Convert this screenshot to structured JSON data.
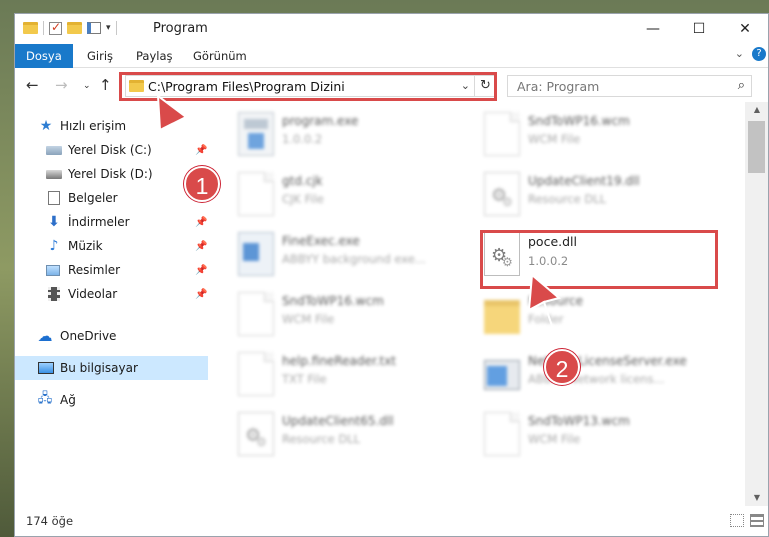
{
  "window": {
    "title": "Program"
  },
  "title_controls": {
    "minimize": "—",
    "maximize": "☐",
    "close": "✕"
  },
  "ribbon": {
    "tabs": [
      "Dosya",
      "Giriş",
      "Paylaş",
      "Görünüm"
    ]
  },
  "nav": {
    "address": "C:\\Program Files\\Program Dizini",
    "search_placeholder": "Ara: Program"
  },
  "sidebar": {
    "items": [
      {
        "label": "Hızlı erişim",
        "icon": "star-icon",
        "pinned": false
      },
      {
        "label": "Yerel Disk (C:)",
        "icon": "drive-icon",
        "pinned": true
      },
      {
        "label": "Yerel Disk (D:)",
        "icon": "drive-icon",
        "pinned": false
      },
      {
        "label": "Belgeler",
        "icon": "document-icon",
        "pinned": false
      },
      {
        "label": "İndirmeler",
        "icon": "download-icon",
        "pinned": true
      },
      {
        "label": "Müzik",
        "icon": "music-icon",
        "pinned": true
      },
      {
        "label": "Resimler",
        "icon": "pictures-icon",
        "pinned": true
      },
      {
        "label": "Videolar",
        "icon": "video-icon",
        "pinned": true
      },
      {
        "label": "OneDrive",
        "icon": "cloud-icon",
        "pinned": false
      },
      {
        "label": "Bu bilgisayar",
        "icon": "computer-icon",
        "pinned": false,
        "selected": true
      },
      {
        "label": "Ağ",
        "icon": "network-icon",
        "pinned": false
      }
    ]
  },
  "files": [
    {
      "name": "program.exe",
      "sub": "1.0.0.2",
      "icon": "setup-icon"
    },
    {
      "name": "SndToWP16.wcm",
      "sub": "WCM File",
      "icon": "document-icon"
    },
    {
      "name": "gtd.cjk",
      "sub": "CJK File",
      "icon": "document-icon"
    },
    {
      "name": "UpdateClient19.dll",
      "sub": "Resource DLL",
      "icon": "gear-icon"
    },
    {
      "name": "FineExec.exe",
      "sub": "ABBYY background exe...",
      "icon": "exe-icon"
    },
    {
      "name": "poce.dll",
      "sub": "1.0.0.2",
      "icon": "gear-icon",
      "highlighted": true
    },
    {
      "name": "SndToWP16.wcm",
      "sub": "WCM File",
      "icon": "document-icon"
    },
    {
      "name": "Resource",
      "sub": "Folder",
      "icon": "folder-icon"
    },
    {
      "name": "help.fineReader.txt",
      "sub": "TXT File",
      "icon": "document-icon"
    },
    {
      "name": "NetworkLicenseServer.exe",
      "sub": "ABBYY Network licens...",
      "icon": "window-icon"
    },
    {
      "name": "UpdateClient65.dll",
      "sub": "Resource DLL",
      "icon": "gear-icon"
    },
    {
      "name": "SndToWP13.wcm",
      "sub": "WCM File",
      "icon": "document-icon"
    }
  ],
  "status": {
    "item_count": "174 öğe"
  },
  "annotations": {
    "marker1": "1",
    "marker2": "2",
    "color": "#d94a4a"
  }
}
